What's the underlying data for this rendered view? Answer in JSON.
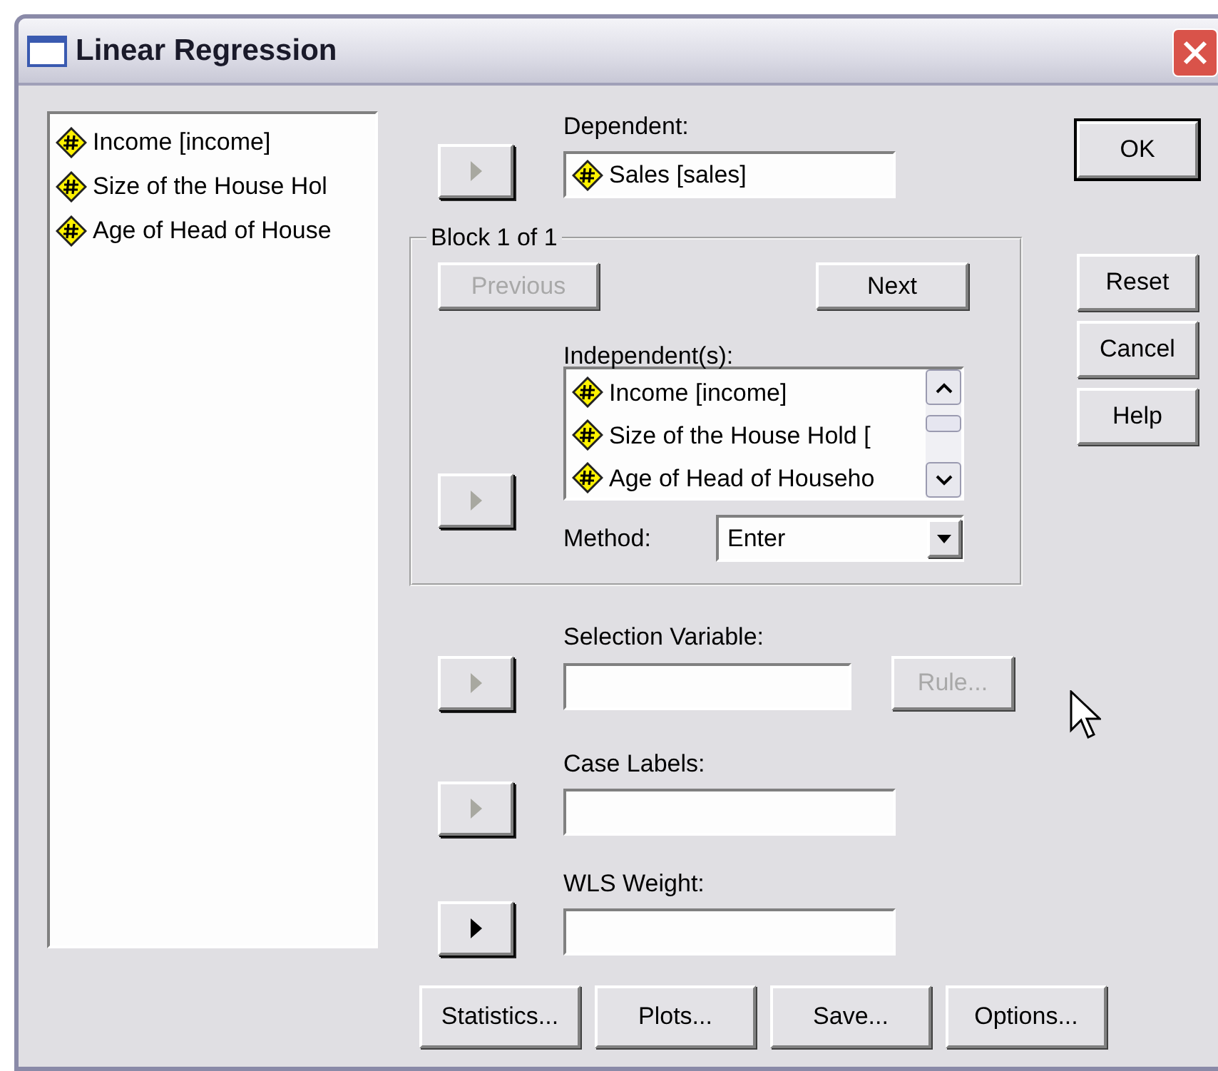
{
  "window": {
    "title": "Linear Regression"
  },
  "variables_list": {
    "items": [
      {
        "label": "Income [income]"
      },
      {
        "label": "Size of the House Hol"
      },
      {
        "label": "Age of Head of House"
      }
    ]
  },
  "dependent": {
    "label": "Dependent:",
    "arrow_disabled": true,
    "items": [
      {
        "label": "Sales [sales]"
      }
    ]
  },
  "block": {
    "title": "Block 1 of 1",
    "previous": {
      "label": "Previous",
      "disabled": true
    },
    "next": {
      "label": "Next",
      "disabled": false
    },
    "independents": {
      "label": "Independent(s):",
      "arrow_disabled": true,
      "items": [
        {
          "label": "Income [income]"
        },
        {
          "label": "Size of the House Hold ["
        },
        {
          "label": "Age of Head of Househo"
        }
      ]
    },
    "method": {
      "label": "Method:",
      "value": "Enter"
    }
  },
  "selection_variable": {
    "label": "Selection Variable:",
    "arrow_disabled": true,
    "rule": {
      "label": "Rule...",
      "disabled": true
    }
  },
  "case_labels": {
    "label": "Case Labels:",
    "arrow_disabled": true
  },
  "wls_weight": {
    "label": "WLS Weight:",
    "arrow_disabled": false
  },
  "side_buttons": [
    {
      "label": "OK",
      "default": true
    },
    {
      "label": "Reset",
      "default": false
    },
    {
      "label": "Cancel",
      "default": false
    },
    {
      "label": "Help",
      "default": false
    }
  ],
  "bottom_buttons": [
    {
      "label": "Statistics..."
    },
    {
      "label": "Plots..."
    },
    {
      "label": "Save..."
    },
    {
      "label": "Options..."
    }
  ]
}
